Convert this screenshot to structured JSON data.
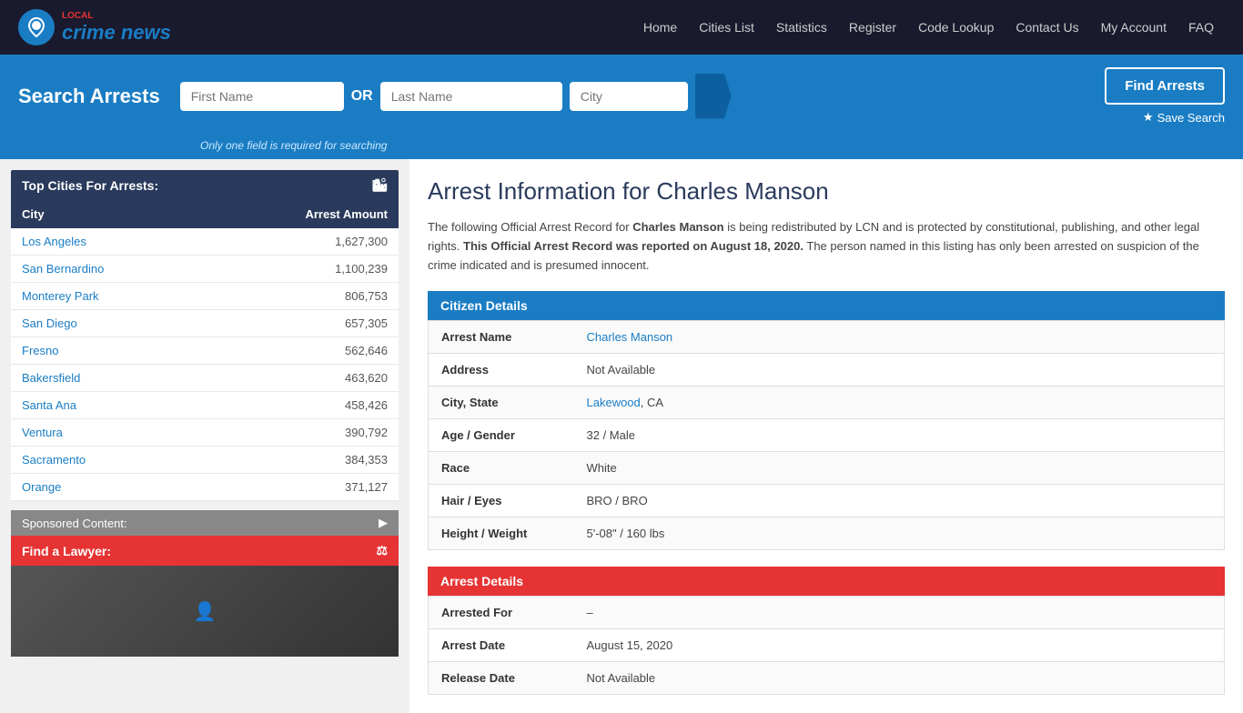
{
  "nav": {
    "links": [
      {
        "label": "Home",
        "name": "home"
      },
      {
        "label": "Cities List",
        "name": "cities-list"
      },
      {
        "label": "Statistics",
        "name": "statistics"
      },
      {
        "label": "Register",
        "name": "register"
      },
      {
        "label": "Code Lookup",
        "name": "code-lookup"
      },
      {
        "label": "Contact Us",
        "name": "contact-us"
      },
      {
        "label": "My Account",
        "name": "my-account"
      },
      {
        "label": "FAQ",
        "name": "faq"
      }
    ]
  },
  "logo": {
    "text": "crime news",
    "local": "LOCAL"
  },
  "search": {
    "title": "Search Arrests",
    "first_name_placeholder": "First Name",
    "last_name_placeholder": "Last Name",
    "city_placeholder": "City",
    "or_label": "OR",
    "hint": "Only one field is required for searching",
    "find_arrests_label": "Find Arrests",
    "save_search_label": "Save Search"
  },
  "sidebar": {
    "top_cities_header": "Top Cities For Arrests:",
    "columns": [
      "City",
      "Arrest Amount"
    ],
    "cities": [
      {
        "name": "Los Angeles",
        "amount": "1,627,300"
      },
      {
        "name": "San Bernardino",
        "amount": "1,100,239"
      },
      {
        "name": "Monterey Park",
        "amount": "806,753"
      },
      {
        "name": "San Diego",
        "amount": "657,305"
      },
      {
        "name": "Fresno",
        "amount": "562,646"
      },
      {
        "name": "Bakersfield",
        "amount": "463,620"
      },
      {
        "name": "Santa Ana",
        "amount": "458,426"
      },
      {
        "name": "Ventura",
        "amount": "390,792"
      },
      {
        "name": "Sacramento",
        "amount": "384,353"
      },
      {
        "name": "Orange",
        "amount": "371,127"
      }
    ],
    "sponsored_label": "Sponsored Content:",
    "find_lawyer_label": "Find a Lawyer:"
  },
  "content": {
    "page_title": "Arrest Information for Charles Manson",
    "intro": "The following Official Arrest Record for ",
    "subject_name": "Charles Manson",
    "intro_middle": " is being redistributed by LCN and is protected by constitutional, publishing, and other legal rights. ",
    "intro_bold": "This Official Arrest Record was reported on August 18, 2020.",
    "intro_end": " The person named in this listing has only been arrested on suspicion of the crime indicated and is presumed innocent.",
    "citizen_details_header": "Citizen Details",
    "arrest_details_header": "Arrest Details",
    "citizen_fields": [
      {
        "label": "Arrest Name",
        "value": "Charles Manson",
        "link": true
      },
      {
        "label": "Address",
        "value": "Not Available",
        "link": false
      },
      {
        "label": "City, State",
        "value": "Lakewood, CA",
        "link": true,
        "link_part": "Lakewood"
      },
      {
        "label": "Age / Gender",
        "value": "32 / Male",
        "link": false
      },
      {
        "label": "Race",
        "value": "White",
        "link": false
      },
      {
        "label": "Hair / Eyes",
        "value": "BRO / BRO",
        "link": false
      },
      {
        "label": "Height / Weight",
        "value": "5'-08\" / 160 lbs",
        "link": false
      }
    ],
    "arrest_fields": [
      {
        "label": "Arrested For",
        "value": "–"
      },
      {
        "label": "Arrest Date",
        "value": "August 15, 2020"
      },
      {
        "label": "Release Date",
        "value": "Not Available"
      }
    ]
  }
}
